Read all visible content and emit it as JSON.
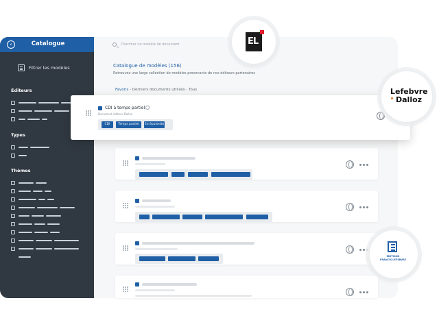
{
  "sidebar": {
    "back_icon": "chevron-left-icon",
    "title": "Catalogue",
    "filter_label": "Filtrer les modèles",
    "sections": {
      "editeurs": "Éditeurs",
      "types": "Types",
      "themes": "Thèmes"
    }
  },
  "search": {
    "placeholder": "Chercher un modèle de document"
  },
  "catalog": {
    "title": "Catalogue de modèles (156)",
    "subtitle": "Retrouvez une large collection de modèles provenants de nos éditeurs partenaires",
    "tabs": {
      "favoris": "Favoris",
      "rest": " - Derniers documents utilisés - Tous"
    }
  },
  "highlighted_card": {
    "title": "CDI à temps partiel",
    "subtitle": "Document éditeur Dalloz",
    "tags": [
      "CDI",
      "Temps partiel",
      "En épuisette"
    ]
  },
  "logos": {
    "lefebvre_dalloz": [
      "Lefebvre",
      "Dalloz"
    ],
    "francis_lefebvre": [
      "ÉDITIONS",
      "FRANCIS LEFEBVRE"
    ]
  },
  "colors": {
    "accent": "#1f5fa6",
    "sidebar_bg": "#303841",
    "brand_red": "#e11d2b",
    "brand_orange": "#e87722"
  }
}
